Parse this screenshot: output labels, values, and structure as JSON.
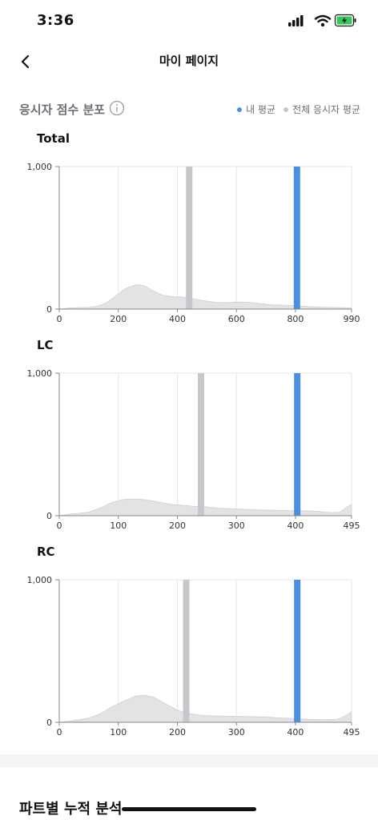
{
  "status_bar": {
    "time": "3:36"
  },
  "nav": {
    "title": "마이 페이지"
  },
  "section": {
    "title": "응시자 점수 분포",
    "legend": [
      {
        "label": "내 평균",
        "color": "#4a90e2"
      },
      {
        "label": "전체 응시자 평균",
        "color": "#c4c6ca"
      }
    ]
  },
  "colors": {
    "my_avg": "#4a90e2",
    "all_avg": "#c6c7cb",
    "density_fill": "#e3e3e5",
    "density_stroke": "#cfd0d3",
    "grid": "#e6e6e6",
    "axis": "#888888"
  },
  "chart_data": [
    {
      "type": "area",
      "title": "Total",
      "xlim": [
        0,
        990
      ],
      "ylim": [
        0,
        1000
      ],
      "x_ticks": [
        0,
        200,
        400,
        600,
        800,
        990
      ],
      "x_tick_labels": [
        "0",
        "200",
        "400",
        "600",
        "800",
        "990"
      ],
      "y_ticks": [
        0,
        1000
      ],
      "y_tick_labels": [
        "0",
        "1,000"
      ],
      "gridlines_x": [
        200,
        400,
        600,
        800
      ],
      "my_average": 805,
      "all_average": 440,
      "density": [
        [
          0,
          0
        ],
        [
          30,
          8
        ],
        [
          60,
          10
        ],
        [
          100,
          12
        ],
        [
          130,
          20
        ],
        [
          160,
          45
        ],
        [
          190,
          90
        ],
        [
          220,
          140
        ],
        [
          250,
          165
        ],
        [
          270,
          172
        ],
        [
          290,
          162
        ],
        [
          320,
          125
        ],
        [
          350,
          98
        ],
        [
          380,
          88
        ],
        [
          410,
          85
        ],
        [
          440,
          78
        ],
        [
          470,
          65
        ],
        [
          500,
          55
        ],
        [
          530,
          48
        ],
        [
          560,
          45
        ],
        [
          600,
          50
        ],
        [
          640,
          48
        ],
        [
          680,
          38
        ],
        [
          720,
          30
        ],
        [
          760,
          28
        ],
        [
          800,
          25
        ],
        [
          840,
          18
        ],
        [
          880,
          14
        ],
        [
          920,
          12
        ],
        [
          960,
          10
        ],
        [
          990,
          8
        ]
      ]
    },
    {
      "type": "area",
      "title": "LC",
      "xlim": [
        0,
        495
      ],
      "ylim": [
        0,
        1000
      ],
      "x_ticks": [
        0,
        100,
        200,
        300,
        400,
        495
      ],
      "x_tick_labels": [
        "0",
        "100",
        "200",
        "300",
        "400",
        "495"
      ],
      "y_ticks": [
        0,
        1000
      ],
      "y_tick_labels": [
        "0",
        "1,000"
      ],
      "gridlines_x": [
        100,
        200,
        300,
        400
      ],
      "my_average": 403,
      "all_average": 240,
      "density": [
        [
          0,
          0
        ],
        [
          15,
          10
        ],
        [
          30,
          15
        ],
        [
          50,
          25
        ],
        [
          70,
          55
        ],
        [
          90,
          95
        ],
        [
          110,
          115
        ],
        [
          130,
          118
        ],
        [
          150,
          110
        ],
        [
          170,
          95
        ],
        [
          190,
          80
        ],
        [
          210,
          72
        ],
        [
          230,
          65
        ],
        [
          250,
          62
        ],
        [
          270,
          52
        ],
        [
          300,
          48
        ],
        [
          330,
          42
        ],
        [
          360,
          38
        ],
        [
          390,
          36
        ],
        [
          420,
          34
        ],
        [
          440,
          30
        ],
        [
          460,
          22
        ],
        [
          475,
          25
        ],
        [
          485,
          55
        ],
        [
          495,
          80
        ]
      ]
    },
    {
      "type": "area",
      "title": "RC",
      "xlim": [
        0,
        495
      ],
      "ylim": [
        0,
        1000
      ],
      "x_ticks": [
        0,
        100,
        200,
        300,
        400,
        495
      ],
      "x_tick_labels": [
        "0",
        "100",
        "200",
        "300",
        "400",
        "495"
      ],
      "y_ticks": [
        0,
        1000
      ],
      "y_tick_labels": [
        "0",
        "1,000"
      ],
      "gridlines_x": [
        100,
        200,
        300,
        400
      ],
      "my_average": 403,
      "all_average": 215,
      "density": [
        [
          0,
          0
        ],
        [
          15,
          8
        ],
        [
          30,
          15
        ],
        [
          50,
          30
        ],
        [
          70,
          60
        ],
        [
          90,
          110
        ],
        [
          110,
          150
        ],
        [
          130,
          185
        ],
        [
          145,
          190
        ],
        [
          160,
          175
        ],
        [
          180,
          130
        ],
        [
          200,
          85
        ],
        [
          220,
          60
        ],
        [
          240,
          50
        ],
        [
          260,
          45
        ],
        [
          300,
          42
        ],
        [
          340,
          38
        ],
        [
          380,
          30
        ],
        [
          420,
          22
        ],
        [
          450,
          18
        ],
        [
          470,
          20
        ],
        [
          485,
          45
        ],
        [
          495,
          75
        ]
      ]
    }
  ],
  "bottom_section": {
    "title": "파트별 누적 분석"
  }
}
